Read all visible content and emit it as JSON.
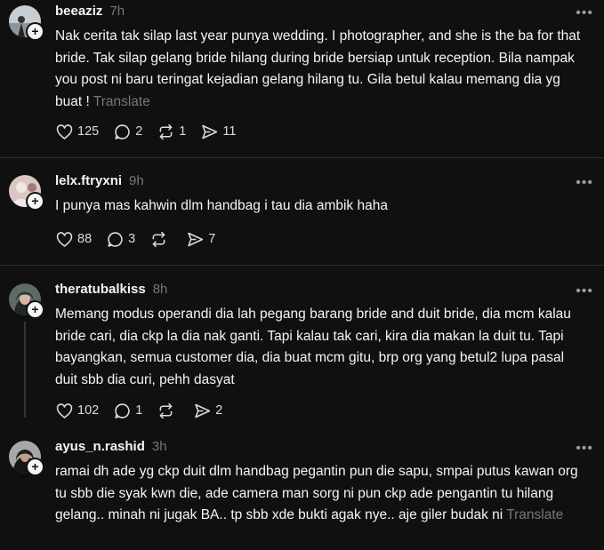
{
  "posts": [
    {
      "username": "beeaziz",
      "time": "7h",
      "text": "Nak cerita tak silap last year punya wedding. I photographer, and she is the ba for that bride. Tak silap gelang bride hilang during bride bersiap untuk reception. Bila nampak you post ni baru teringat kejadian gelang hilang tu. Gila betul kalau memang dia yg buat !",
      "translate": "Translate",
      "likes": "125",
      "replies": "2",
      "reposts": "1",
      "shares": "11"
    },
    {
      "username": "lelx.ftryxni",
      "time": "9h",
      "text": "I punya mas kahwin dlm handbag i tau dia ambik haha",
      "likes": "88",
      "replies": "3",
      "reposts": "",
      "shares": "7"
    },
    {
      "username": "theratubalkiss",
      "time": "8h",
      "text": "Memang modus operandi dia lah pegang barang bride and duit bride, dia mcm kalau bride cari, dia ckp la dia nak ganti. Tapi kalau tak cari, kira dia makan la duit tu. Tapi bayangkan, semua customer dia, dia buat mcm gitu, brp org yang betul2 lupa pasal duit sbb dia curi, pehh dasyat",
      "likes": "102",
      "replies": "1",
      "reposts": "",
      "shares": "2"
    },
    {
      "username": "ayus_n.rashid",
      "time": "3h",
      "text": "ramai dh ade yg ckp duit dlm handbag pegantin pun die sapu, smpai putus kawan org tu sbb die syak kwn die, ade camera man sorg ni pun ckp ade pengantin tu hilang gelang.. minah ni jugak BA.. tp sbb xde bukti agak nye.. aje giler budak ni",
      "translate": "Translate"
    }
  ],
  "more_glyph": "•••",
  "plus_glyph": "+",
  "colors": {
    "background": "#101010",
    "text": "#f3f5f7",
    "muted": "#777777",
    "divider": "#2d2d2d"
  }
}
